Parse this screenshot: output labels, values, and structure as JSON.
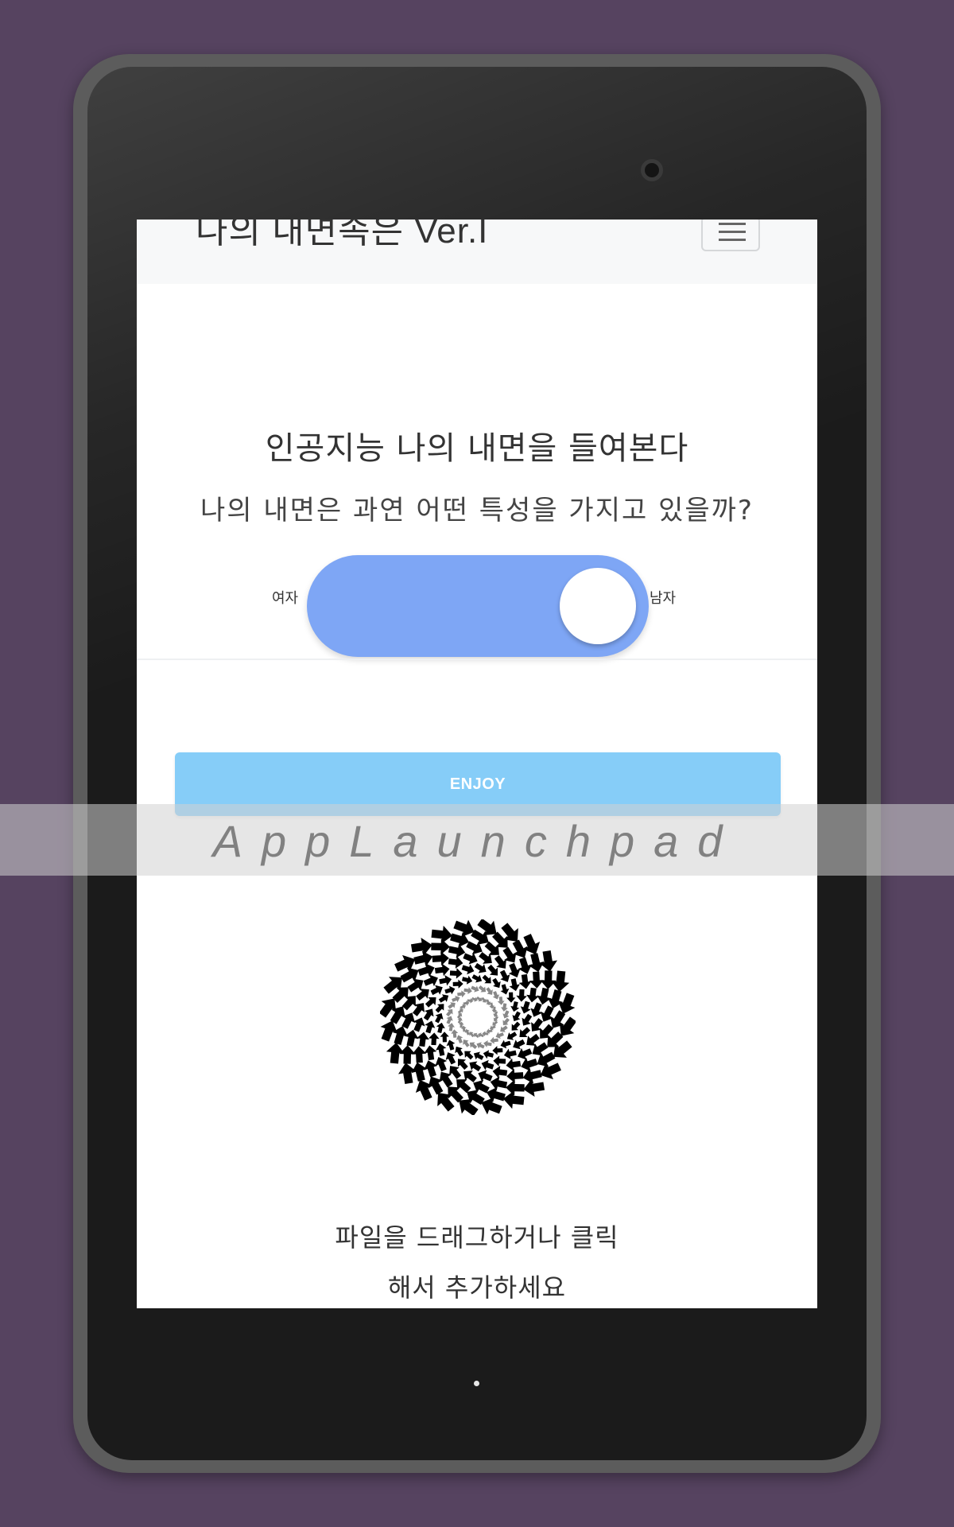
{
  "navbar": {
    "brand": "나의 내면속은 Ver.I",
    "menu_icon": "hamburger-menu-icon"
  },
  "main": {
    "headline": "인공지능 나의 내면을 들여본다",
    "subheadline": "나의 내면은 과연 어떤 특성을 가지고 있을까?",
    "gender_toggle": {
      "left_label": "여자",
      "right_label": "남자",
      "selected": "남자",
      "track_color": "#7ea6f5"
    },
    "enjoy_button": {
      "label": "ENJOY",
      "color": "#86cdf8"
    },
    "upload": {
      "icon": "spiral-arrows-icon",
      "line1": "파일을 드래그하거나 클릭",
      "line2": "해서 추가하세요"
    }
  },
  "watermark": {
    "text": "AppLaunchpad"
  },
  "colors": {
    "background": "#564360",
    "device_frame": "#1b1b1b"
  }
}
